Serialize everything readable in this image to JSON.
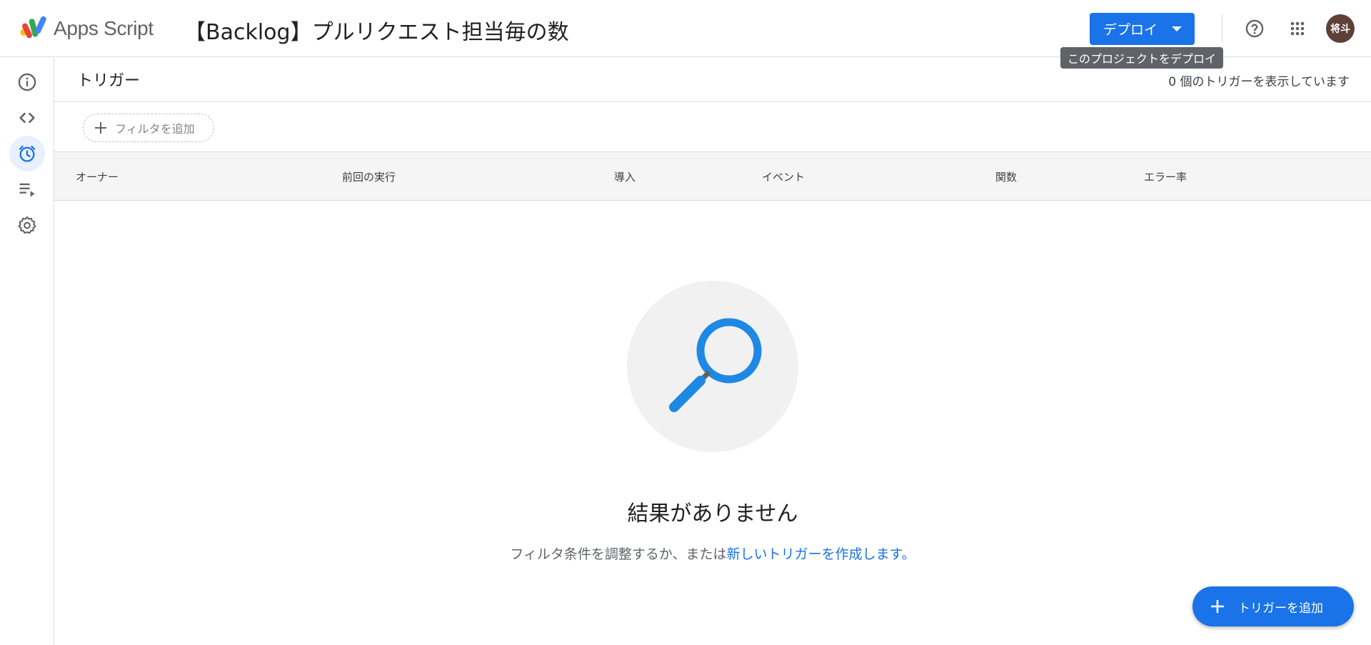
{
  "header": {
    "app_name": "Apps Script",
    "project_title": "【Backlog】プルリクエスト担当毎の数",
    "deploy_label": "デプロイ",
    "deploy_tooltip": "このプロジェクトをデプロイ",
    "avatar_initials": "将斗"
  },
  "sidebar": {
    "items": [
      {
        "name": "overview",
        "icon": "info-icon"
      },
      {
        "name": "editor",
        "icon": "code-icon"
      },
      {
        "name": "triggers",
        "icon": "alarm-clock-icon",
        "active": true
      },
      {
        "name": "executions",
        "icon": "playlist-play-icon"
      },
      {
        "name": "settings",
        "icon": "gear-icon"
      }
    ]
  },
  "page": {
    "title": "トリガー",
    "trigger_count": "0 個のトリガーを表示しています",
    "add_filter_label": "フィルタを追加"
  },
  "table": {
    "columns": [
      "オーナー",
      "前回の実行",
      "導入",
      "イベント",
      "関数",
      "エラー率"
    ]
  },
  "empty_state": {
    "icon": "magnifier-icon",
    "title": "結果がありません",
    "subtitle": "フィルタ条件を調整するか、または",
    "link": "新しいトリガーを作成します。"
  },
  "fab": {
    "label": "トリガーを追加"
  },
  "colors": {
    "accent": "#1a73e8",
    "magnifier": "#1e88e5",
    "avatar_bg": "#5d4037"
  }
}
